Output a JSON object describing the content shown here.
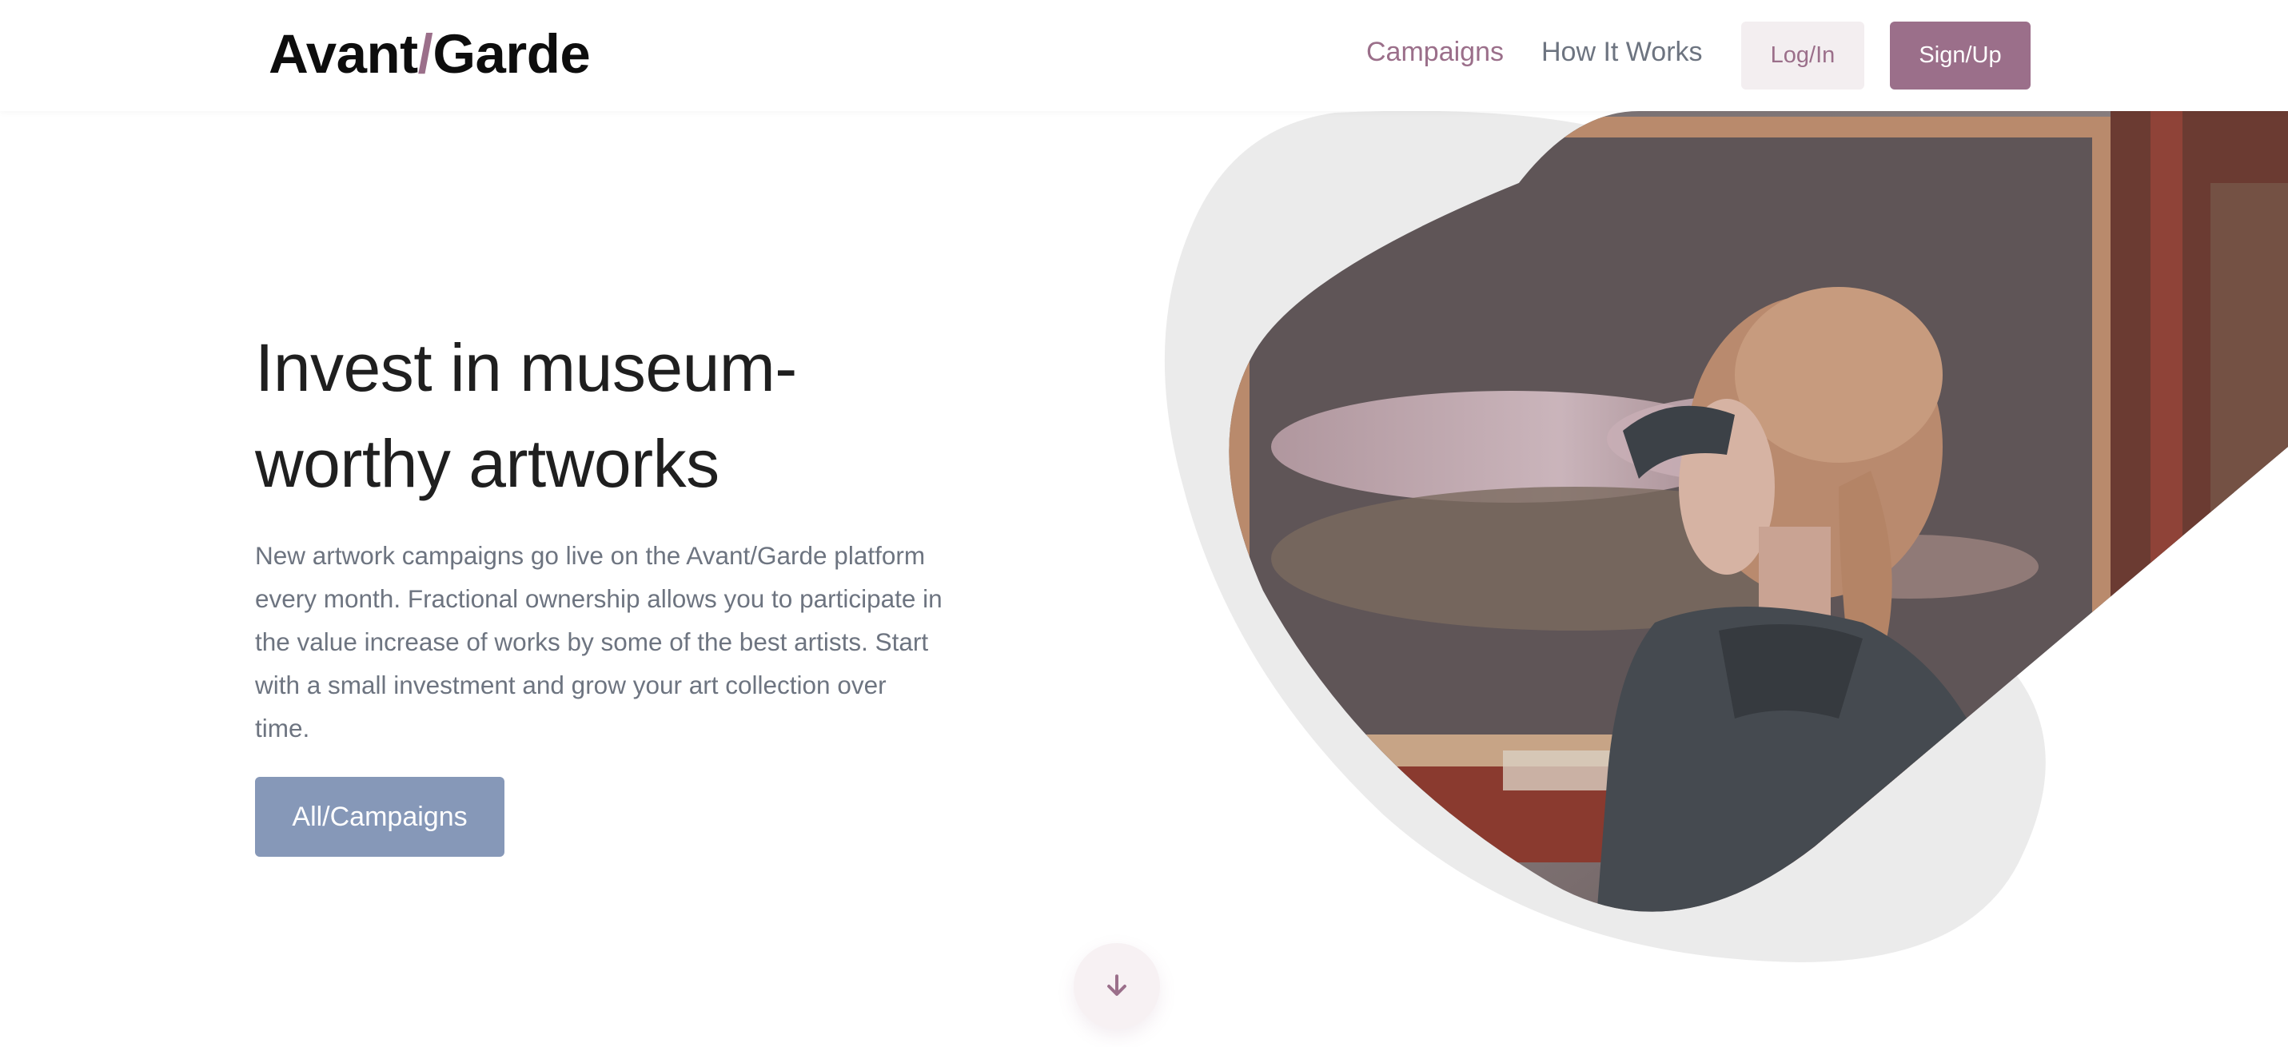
{
  "header": {
    "logo_part1": "Avant",
    "logo_slash": "/",
    "logo_part2": "Garde",
    "nav_campaigns": "Campaigns",
    "nav_how_it_works": "How It Works",
    "login_label": "Log/In",
    "signup_label": "Sign/Up"
  },
  "hero": {
    "title_line1": "Invest in museum-",
    "title_line2": "worthy artworks",
    "description": "New artwork campaigns go live on the Avant/Garde platform every month. Fractional ownership allows you to participate in the value increase of works by some of the best artists. Start with a small investment and grow your art collection over time.",
    "cta_label": "All/Campaigns",
    "image_subject": "woman-viewing-painting-photo"
  },
  "icons": {
    "scroll_down": "arrow-down-icon"
  },
  "colors": {
    "brand_mauve": "#9b6f8a",
    "cta_blue": "#8698b8",
    "text_gray": "#6d7480",
    "blob_gray": "#ebebeb"
  }
}
